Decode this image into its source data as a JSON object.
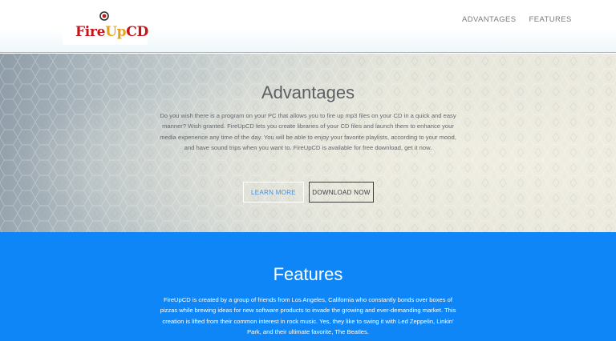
{
  "header": {
    "logo": {
      "part1": "Fire",
      "part2": "Up",
      "part3": "CD"
    },
    "nav": [
      {
        "label": "ADVANTAGES"
      },
      {
        "label": "FEATURES"
      }
    ]
  },
  "advantages": {
    "title": "Advantages",
    "body": "Do you wish there is a program on your PC that allows you to fire up mp3 files on your CD in a quick and easy manner? Wish granted. FireUpCD lets you create libraries of your CD files and launch them to enhance your media experience any time of the day. You will be able to enjoy your favorite playlists, according to your mood, and have sound trips when you want to. FireUpCD is available for free download, get it now.",
    "learn_more_label": "LEARN MORE",
    "download_label": "DOWNLOAD NOW"
  },
  "features": {
    "title": "Features",
    "body": "FireUpCD is created by a group of friends from Los Angeles, California who constantly bonds over boxes of pizzas while brewing ideas for new software products to invade the growing and ever-demanding market. This creation is lifted from their common interest in rock music. Yes, they like to swing it with Led Zeppelin, Linkin' Park, and their ultimate favorite, The Beatles."
  },
  "colors": {
    "brand_red": "#c0161c",
    "brand_orange": "#e8a21a",
    "features_bg": "#0e86f8",
    "learn_more_text": "#4a90d9"
  },
  "icons": {
    "logo_mark": "disc-icon"
  }
}
